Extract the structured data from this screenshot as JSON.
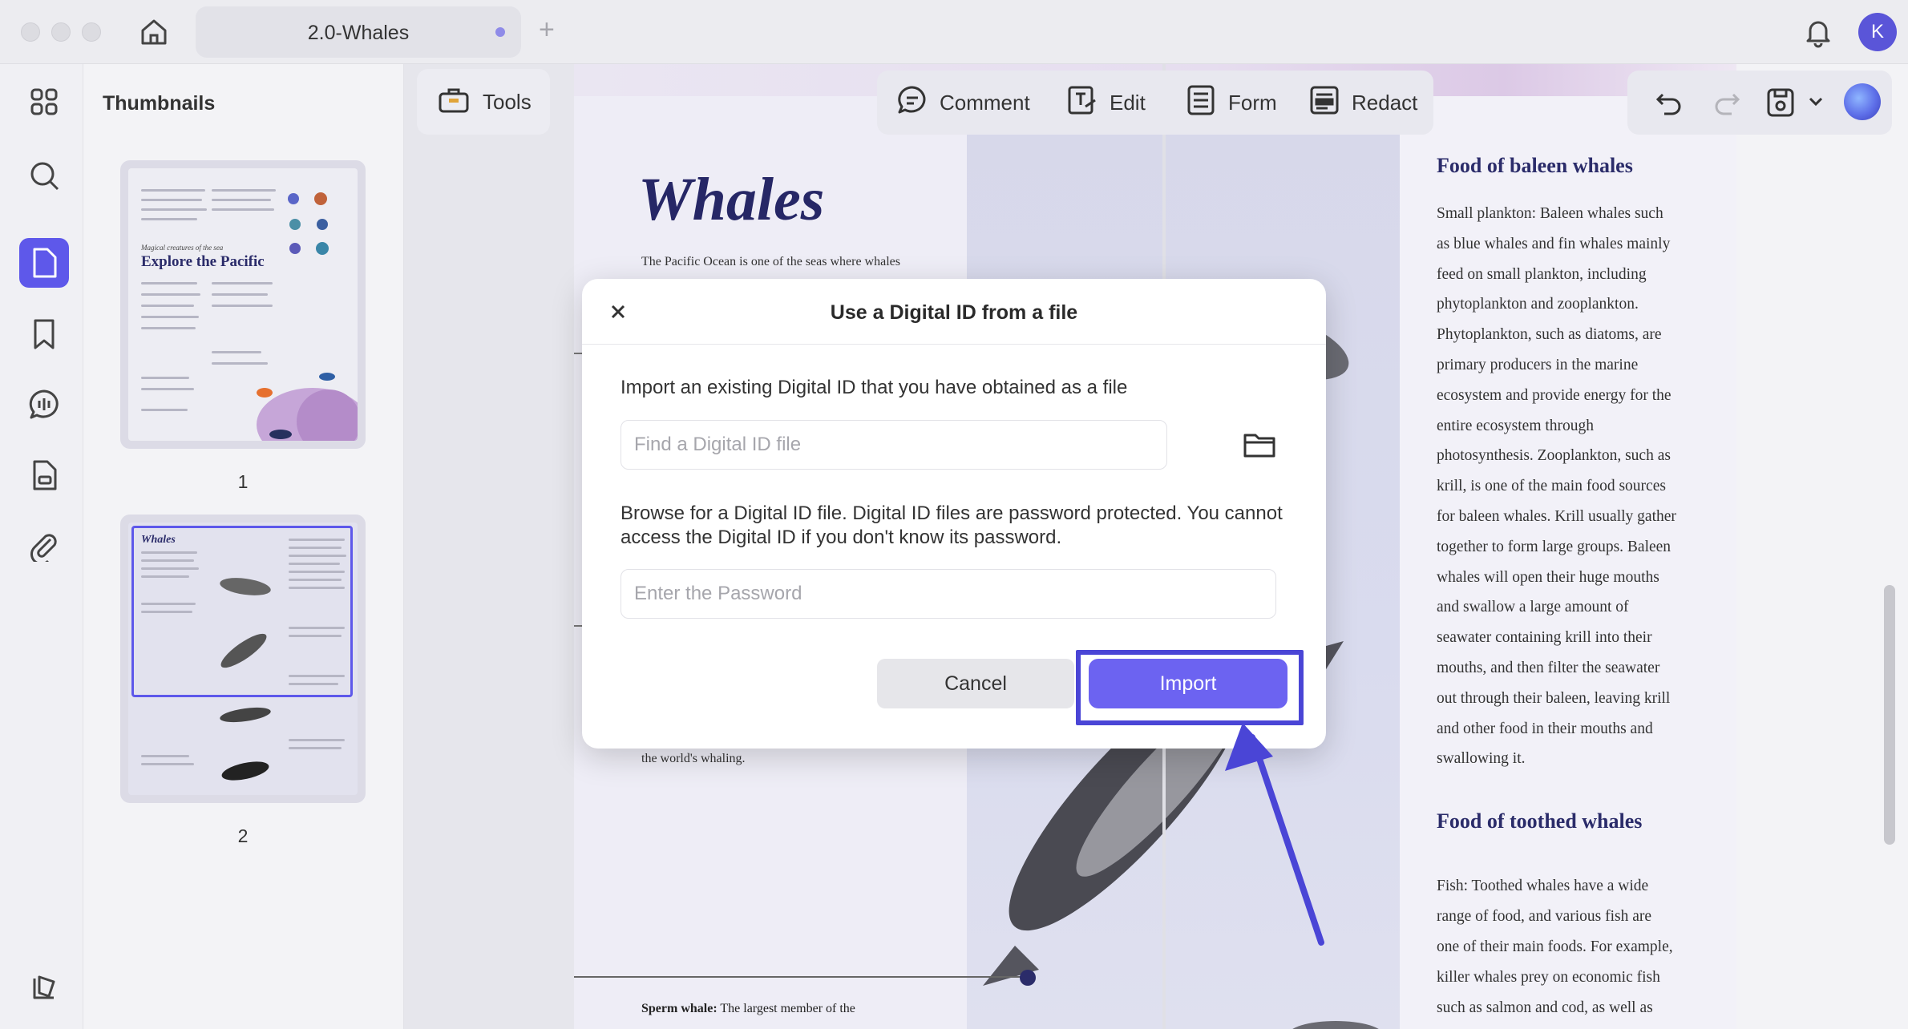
{
  "window": {
    "tab_title": "2.0-Whales",
    "new_tab_symbol": "+",
    "avatar_initial": "K"
  },
  "sidebar": {
    "items": [
      {
        "name": "grid-icon"
      },
      {
        "name": "search-icon"
      },
      {
        "name": "document-icon",
        "active": true
      },
      {
        "name": "bookmark-icon"
      },
      {
        "name": "comment-icon"
      },
      {
        "name": "page-icon"
      },
      {
        "name": "attachment-icon"
      }
    ],
    "bottom": {
      "name": "layers-icon"
    }
  },
  "thumbnails": {
    "title": "Thumbnails",
    "pages": [
      {
        "number": "1",
        "heading": "Explore the Pacific",
        "subheading": "Magical creatures of the sea"
      },
      {
        "number": "2",
        "heading": "Whales"
      }
    ]
  },
  "toolbar": {
    "tools_label": "Tools",
    "modes": [
      {
        "label": "Comment",
        "icon": "comment-icon"
      },
      {
        "label": "Edit",
        "icon": "edit-icon"
      },
      {
        "label": "Form",
        "icon": "form-icon"
      },
      {
        "label": "Redact",
        "icon": "redact-icon"
      }
    ]
  },
  "document": {
    "title": "Whales",
    "intro": "The Pacific Ocean is one of the seas where whales",
    "whaling": "the world's whaling.",
    "sperm_label": "Sperm whale:",
    "sperm_text": "The largest member of the",
    "food_baleen_title": "Food of baleen whales",
    "food_baleen_lines": [
      "Small plankton: Baleen whales such",
      "as blue whales and fin whales mainly",
      "feed on small plankton, including",
      "phytoplankton and zooplankton.",
      "Phytoplankton, such as diatoms, are",
      "primary producers in the marine",
      "ecosystem and provide energy for the",
      "entire ecosystem through",
      "photosynthesis. Zooplankton, such as",
      "krill, is one of the main food sources",
      "for baleen whales. Krill usually gather",
      "together to form large groups. Baleen",
      "whales will open their huge mouths",
      "and swallow a large amount of",
      "seawater containing krill into their",
      "mouths, and then filter the seawater",
      "out through their baleen, leaving krill",
      "and other food in their mouths and",
      "swallowing it."
    ],
    "food_toothed_title": "Food of toothed whales",
    "food_toothed_lines": [
      "Fish: Toothed whales have a wide",
      "range of food, and various fish are",
      "one of their main foods. For example,",
      "killer whales prey on economic fish",
      "such as salmon and cod, as well as"
    ]
  },
  "modal": {
    "title": "Use a Digital ID from a file",
    "close_symbol": "×",
    "description": "Import an existing Digital ID that you have obtained as a file",
    "file_placeholder": "Find a Digital ID file",
    "browse_description": "Browse for a Digital ID file. Digital ID files are password protected. You cannot access the Digital ID if you don't know its password.",
    "password_placeholder": "Enter the Password",
    "cancel_label": "Cancel",
    "import_label": "Import"
  },
  "colors": {
    "accent": "#6c63f1",
    "annotation": "#4a45d6",
    "doc_heading": "#2b2c6a"
  }
}
